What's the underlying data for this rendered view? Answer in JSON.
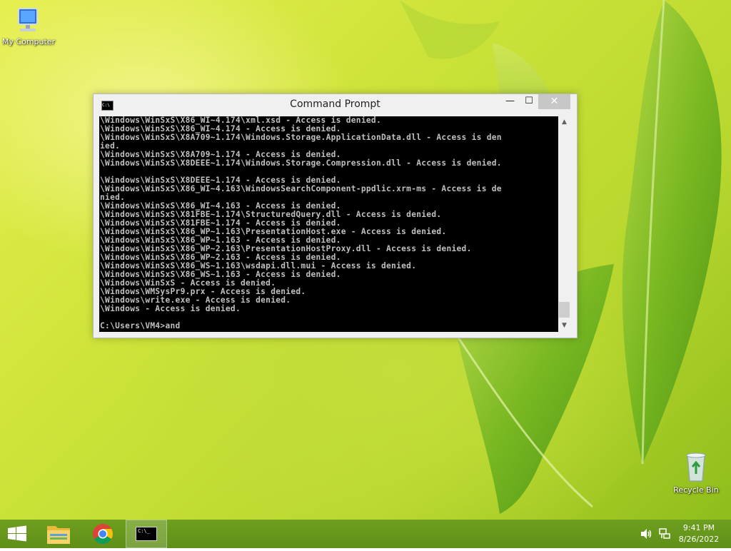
{
  "desktop": {
    "icons": [
      {
        "label": "My Computer",
        "icon": "computer-icon"
      },
      {
        "label": "Recycle Bin",
        "icon": "recycle-bin-icon"
      }
    ]
  },
  "window": {
    "title": "Command Prompt",
    "minimize_label": "—",
    "maximize_label": "☐",
    "close_label": "✕",
    "icon_label": "C:\\",
    "output": "\\Windows\\WinSxS\\X86_WI~4.174\\xml.xsd - Access is denied.\n\\Windows\\WinSxS\\X86_WI~4.174 - Access is denied.\n\\Windows\\WinSxS\\X8A709~1.174\\Windows.Storage.ApplicationData.dll - Access is den\nied.\n\\Windows\\WinSxS\\X8A709~1.174 - Access is denied.\n\\Windows\\WinSxS\\X8DEEE~1.174\\Windows.Storage.Compression.dll - Access is denied.\n\n\\Windows\\WinSxS\\X8DEEE~1.174 - Access is denied.\n\\Windows\\WinSxS\\X86_WI~4.163\\WindowsSearchComponent-ppdlic.xrm-ms - Access is de\nnied.\n\\Windows\\WinSxS\\X86_WI~4.163 - Access is denied.\n\\Windows\\WinSxS\\X81FBE~1.174\\StructuredQuery.dll - Access is denied.\n\\Windows\\WinSxS\\X81FBE~1.174 - Access is denied.\n\\Windows\\WinSxS\\X86_WP~1.163\\PresentationHost.exe - Access is denied.\n\\Windows\\WinSxS\\X86_WP~1.163 - Access is denied.\n\\Windows\\WinSxS\\X86_WP~2.163\\PresentationHostProxy.dll - Access is denied.\n\\Windows\\WinSxS\\X86_WP~2.163 - Access is denied.\n\\Windows\\WinSxS\\X86_WS~1.163\\wsdapi.dll.mui - Access is denied.\n\\Windows\\WinSxS\\X86_WS~1.163 - Access is denied.\n\\Windows\\WinSxS - Access is denied.\n\\Windows\\WMSysPr9.prx - Access is denied.\n\\Windows\\write.exe - Access is denied.\n\\Windows - Access is denied.\n\nC:\\Users\\VM4>and"
  },
  "taskbar": {
    "items": [
      "start-icon",
      "file-explorer-icon",
      "chrome-icon",
      "command-prompt-icon"
    ],
    "cmd_icon_label": "C:\\_"
  },
  "tray": {
    "time": "9:41 PM",
    "date": "8/26/2022"
  },
  "colors": {
    "taskbar": "#5f8f18",
    "console_bg": "#000000",
    "console_text": "#c0c0c0",
    "close_button": "#c7c7c7"
  }
}
